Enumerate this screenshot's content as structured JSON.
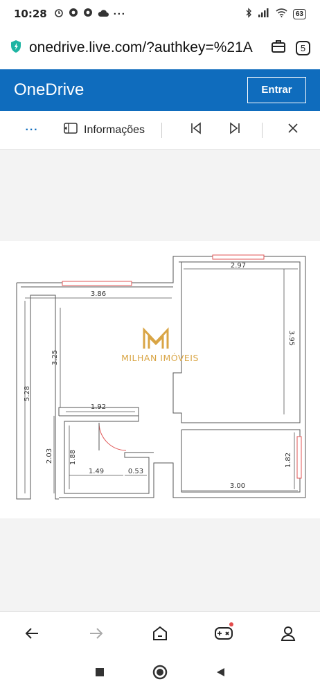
{
  "status_bar": {
    "time": "10:28",
    "battery": "63",
    "left_icons": [
      "alarm-icon",
      "chrome-icon",
      "chrome-icon",
      "cloud-icon",
      "more-dots-icon"
    ],
    "right_icons": [
      "bluetooth-icon",
      "signal-icon",
      "wifi-icon"
    ]
  },
  "browser": {
    "url": "onedrive.live.com/?authkey=%21A",
    "tab_count": "5",
    "icons": [
      "secure-shield-icon",
      "briefcase-icon"
    ]
  },
  "onedrive": {
    "logo": "OneDrive",
    "signin_label": "Entrar"
  },
  "toolbar": {
    "more_label": "···",
    "info_label": "Informações"
  },
  "floorplan": {
    "watermark_brand": "MILHAN IMÓVEIS",
    "dimensions": {
      "top_right_width": "2.97",
      "top_left_width": "3.86",
      "left_height": "3.25",
      "right_height": "3.95",
      "total_height": "5.28",
      "bath_width": "1.92",
      "lower_left_height": "2.03",
      "bath_height": "1.88",
      "bath_inner_width": "1.49",
      "small_width": "0.53",
      "right_small_height": "1.82",
      "bottom_right_width": "3.00"
    }
  },
  "bottom_nav": {
    "items": [
      "back-arrow-icon",
      "forward-arrow-icon",
      "home-icon",
      "game-icon",
      "profile-icon"
    ]
  },
  "system_nav": {
    "items": [
      "square-recent-icon",
      "circle-home-icon",
      "triangle-back-icon"
    ]
  }
}
